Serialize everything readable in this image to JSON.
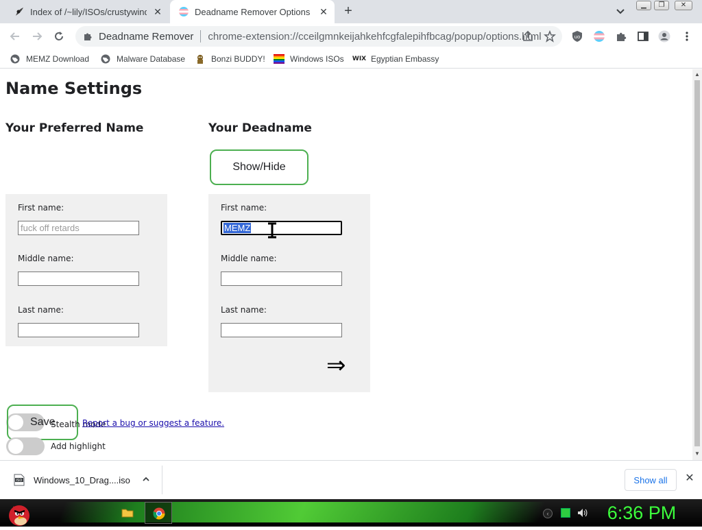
{
  "tabs": [
    {
      "title": "Index of /~lily/ISOs/crustywindo",
      "active": false,
      "icon": "apache-feather-icon"
    },
    {
      "title": "Deadname Remover Options",
      "active": true,
      "icon": "trans-flag-icon"
    }
  ],
  "address_bar": {
    "site_name": "Deadname Remover",
    "url": "chrome-extension://cceilgmnkeijahkehfcgfalepihfbcag/popup/options.html"
  },
  "bookmarks": [
    {
      "label": "MEMZ Download",
      "icon": "globe-icon"
    },
    {
      "label": "Malware Database",
      "icon": "globe-icon"
    },
    {
      "label": "Bonzi BUDDY!",
      "icon": "bonzi-icon"
    },
    {
      "label": "Windows ISOs",
      "icon": "rainbow-flag-icon"
    },
    {
      "label": "Egyptian Embassy",
      "icon": "wix-icon"
    }
  ],
  "page": {
    "title": "Name Settings",
    "preferred": {
      "heading": "Your Preferred Name",
      "first_label": "First name:",
      "first_placeholder": "fuck off retards",
      "middle_label": "Middle name:",
      "middle_value": "",
      "last_label": "Last name:",
      "last_value": ""
    },
    "deadname": {
      "heading": "Your Deadname",
      "show_hide_label": "Show/Hide",
      "first_label": "First name:",
      "first_value": "MEMZ",
      "middle_label": "Middle name:",
      "middle_value": "",
      "last_label": "Last name:",
      "last_value": "",
      "arrow": "⇒"
    },
    "save_label": "Save",
    "stealth_label": "Stealth mode",
    "stealth_on": false,
    "highlight_label": "Add highlight",
    "highlight_on": false,
    "bug_link": "Report a bug or suggest a feature."
  },
  "downloads": {
    "file_name": "Windows_10_Drag....iso",
    "show_all_label": "Show all"
  },
  "taskbar": {
    "clock": "6:36 PM"
  },
  "colors": {
    "accent_green": "#4caf50",
    "selection_blue": "#3367d6",
    "link_blue": "#1a0dab",
    "clock_green": "#3cff3c"
  }
}
